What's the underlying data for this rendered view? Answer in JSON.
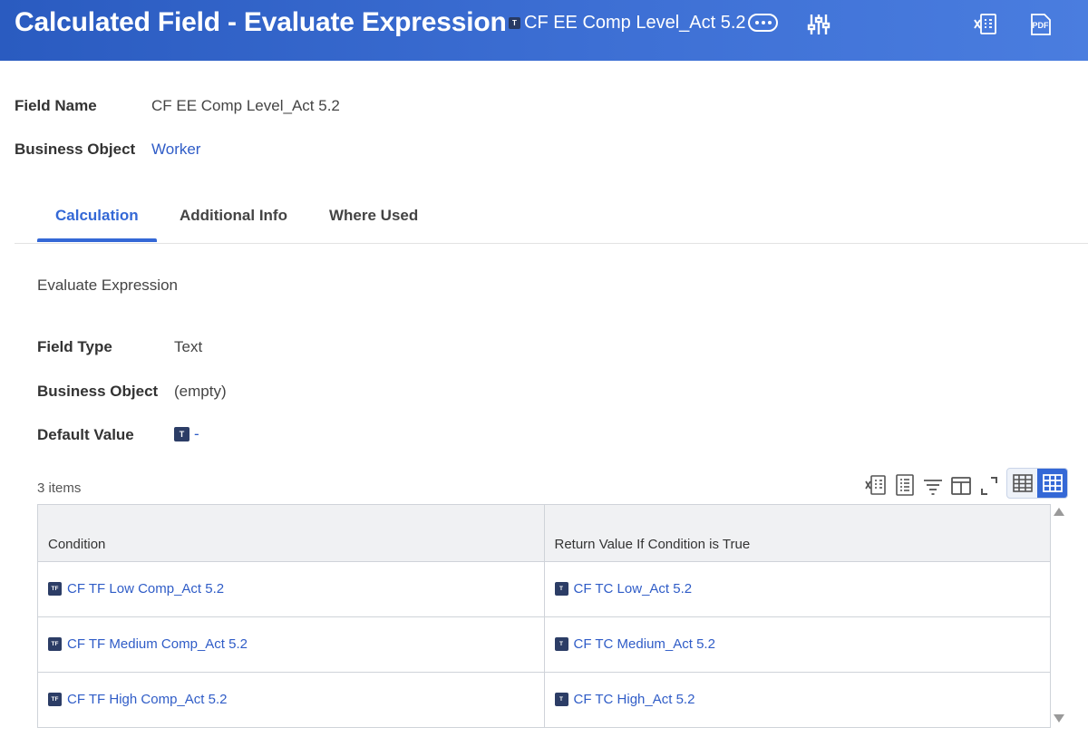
{
  "header": {
    "title": "Calculated Field - Evaluate Expression",
    "field_badge": "T",
    "field_name": "CF EE Comp Level_Act 5.2",
    "icons": [
      "related-actions-icon",
      "configure-icon",
      "export-excel-icon",
      "export-pdf-icon"
    ],
    "pdf_label": "PDF"
  },
  "info": {
    "field_name_label": "Field Name",
    "field_name_value": "CF EE Comp Level_Act 5.2",
    "business_object_label": "Business Object",
    "business_object_value": "Worker"
  },
  "tabs": [
    {
      "label": "Calculation",
      "active": true
    },
    {
      "label": "Additional Info",
      "active": false
    },
    {
      "label": "Where Used",
      "active": false
    }
  ],
  "calculation": {
    "section_title": "Evaluate Expression",
    "field_type_label": "Field Type",
    "field_type_value": "Text",
    "business_object_label": "Business Object",
    "business_object_value": "(empty)",
    "default_value_label": "Default Value",
    "default_value_badge": "T",
    "default_value_value": "-"
  },
  "grid": {
    "items_count": "3 items",
    "toolbar_icons": [
      "export-excel-icon",
      "export-list-icon",
      "filter-icon",
      "columns-icon",
      "fullscreen-icon",
      "table-view-icon",
      "grid-view-icon"
    ],
    "columns": [
      "Condition",
      "Return Value If Condition is True"
    ],
    "rows": [
      {
        "condition_badge": "TF",
        "condition": "CF TF Low Comp_Act 5.2",
        "return_badge": "T",
        "return_value": "CF TC Low_Act 5.2"
      },
      {
        "condition_badge": "TF",
        "condition": "CF TF Medium Comp_Act 5.2",
        "return_badge": "T",
        "return_value": "CF TC Medium_Act 5.2"
      },
      {
        "condition_badge": "TF",
        "condition": "CF TF High Comp_Act 5.2",
        "return_badge": "T",
        "return_value": "CF TC High_Act 5.2"
      }
    ]
  },
  "colors": {
    "header_bg": "#3d6fd4",
    "accent": "#3468d6",
    "link": "#2f5cc7",
    "badge": "#2c3d66"
  }
}
